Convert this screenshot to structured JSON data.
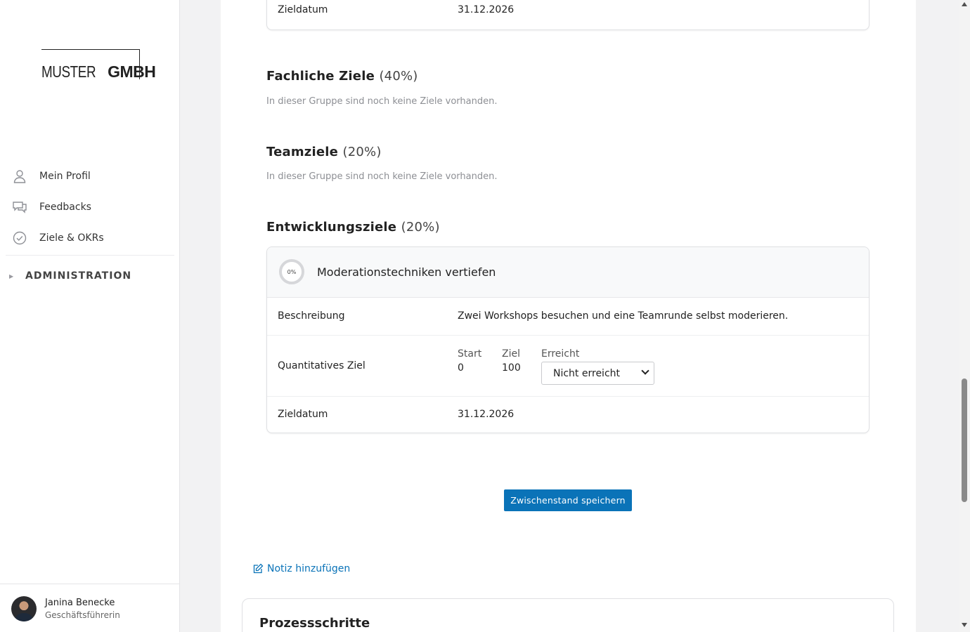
{
  "brand": {
    "logo_light": "MUSTER",
    "logo_bold": "GMBH"
  },
  "sidebar": {
    "items": [
      {
        "label": "Mein Profil",
        "icon": "user-icon"
      },
      {
        "label": "Feedbacks",
        "icon": "chat-bubbles-icon"
      },
      {
        "label": "Ziele & OKRs",
        "icon": "check-circle-icon"
      }
    ],
    "admin_label": "ADMINISTRATION",
    "user": {
      "name": "Janina Benecke",
      "role": "Geschäftsführerin"
    }
  },
  "top_card": {
    "date_label": "Zieldatum",
    "date_value": "31.12.2026"
  },
  "groups": [
    {
      "title": "Fachliche Ziele",
      "weight": "(40%)",
      "empty_text": "In dieser Gruppe sind noch keine Ziele vorhanden."
    },
    {
      "title": "Teamziele",
      "weight": "(20%)",
      "empty_text": "In dieser Gruppe sind noch keine Ziele vorhanden."
    },
    {
      "title": "Entwicklungsziele",
      "weight": "(20%)"
    }
  ],
  "goal": {
    "progress_text": "0%",
    "progress": 0,
    "title": "Moderationstechniken vertiefen",
    "description_label": "Beschreibung",
    "description": "Zwei Workshops besuchen und eine Teamrunde selbst moderieren.",
    "quant_label": "Quantitatives Ziel",
    "start_label": "Start",
    "start_value": "0",
    "target_label": "Ziel",
    "target_value": "100",
    "achieved_label": "Erreicht",
    "achieved_selected": "Nicht erreicht",
    "date_label": "Zieldatum",
    "date_value": "31.12.2026"
  },
  "actions": {
    "save_label": "Zwischenstand speichern",
    "note_label": "Notiz hinzufügen"
  },
  "process": {
    "title": "Prozessschritte"
  },
  "colors": {
    "accent": "#0a73b8"
  }
}
